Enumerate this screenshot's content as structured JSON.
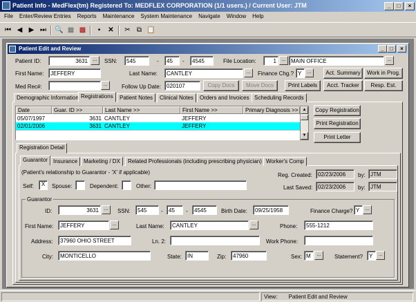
{
  "window": {
    "title": "Patient Info - MedFlex(tm)    Registered To: MEDFLEX CORPORATION (1/1 users.) / Current User: JTM"
  },
  "menu": [
    "File",
    "Enter/Review Entries",
    "Reports",
    "Maintenance",
    "System Maintenance",
    "Navigate",
    "Window",
    "Help"
  ],
  "toolbar_icons": [
    "first-record-icon",
    "prev-record-icon",
    "next-record-icon",
    "last-record-icon",
    "search-icon",
    "grid-icon",
    "delete-grid-icon",
    "save-icon",
    "close-icon",
    "cut-icon",
    "copy-icon",
    "paste-icon"
  ],
  "child": {
    "title": "Patient Edit and Review"
  },
  "header": {
    "patient_id_label": "Patient ID:",
    "patient_id": "3631",
    "ssn_label": "SSN:",
    "ssn1": "545",
    "ssn2": "45",
    "ssn3": "4545",
    "file_location_label": "File Location:",
    "file_location_num": "1",
    "file_location_name": "MAIN OFFICE",
    "first_name_label": "First Name:",
    "first_name": "JEFFERY",
    "last_name_label": "Last Name:",
    "last_name": "CANTLEY",
    "finance_chg_label": "Finance Chg.?",
    "finance_chg": "Y",
    "med_rec_label": "Med Rec#:",
    "med_rec": "",
    "follow_up_label": "Follow Up Date:",
    "follow_up": "020107",
    "dash": "-",
    "ellipsis": "...",
    "check_mark": "X"
  },
  "header_buttons": {
    "act_summary": "Act. Summary",
    "work_in_prog": "Work in Prog.",
    "copy_docs": "Copy Docs",
    "move_docs": "Move Docs",
    "print_labels": "Print Labels",
    "acct_tracker": "Acct. Tracker",
    "resp_est": "Resp. Est."
  },
  "main_tabs": [
    "Demographic Information",
    "Registrations",
    "Patient Notes",
    "Clinical Notes",
    "Orders and Invoices",
    "Scheduling Records"
  ],
  "grid": {
    "headers": [
      "Date",
      "Guar. ID >>",
      "Last Name >>",
      "First Name >>",
      "Primary Diagnosis >>"
    ],
    "rows": [
      [
        "05/07/1997",
        "3631",
        "CANTLEY",
        "JEFFERY",
        ""
      ],
      [
        "02/01/2006",
        "3631",
        "CANTLEY",
        "JEFFERY",
        ""
      ]
    ]
  },
  "reg_buttons": {
    "copy": "Copy Registration",
    "print": "Print Registration",
    "letter": "Print Letter"
  },
  "reg_detail_tab": "Registration Detail",
  "sub_tabs": [
    "Guarantor",
    "Insurance",
    "Marketing / DX",
    "Related Professionals (including prescribing physician)",
    "Worker's Comp"
  ],
  "relationship": {
    "note": "(Patient's relationship to Guarantor - 'X' if applicable)",
    "self": "Self:",
    "self_val": "X",
    "spouse": "Spouse:",
    "dependent": "Dependent:",
    "other": "Other:"
  },
  "reg_info": {
    "created_label": "Reg. Created:",
    "created": "02/23/2006",
    "by_label": "by:",
    "created_by": "JTM",
    "saved_label": "Last Saved:",
    "saved": "02/23/2006",
    "saved_by": "JTM"
  },
  "guarantor": {
    "group_label": "Guarantor",
    "id_label": "ID:",
    "id": "3631",
    "ssn_label": "SSN:",
    "ssn1": "545",
    "ssn2": "45",
    "ssn3": "4545",
    "birth_label": "Birth Date:",
    "birth": "09/25/1958",
    "finance_label": "Finance Charge?",
    "finance": "Y",
    "first_label": "First Name:",
    "first": "JEFFERY",
    "last_label": "Last Name:",
    "last": "CANTLEY",
    "phone_label": "Phone:",
    "phone": "555-1212",
    "address_label": "Address:",
    "address": "37960 OHIO STREET",
    "ln2_label": "Ln. 2:",
    "ln2": "",
    "work_label": "Work Phone:",
    "work": "",
    "city_label": "City:",
    "city": "MONTICELLO",
    "state_label": "State:",
    "state": "IN",
    "zip_label": "Zip:",
    "zip": "47960",
    "sex_label": "Sex:",
    "sex": "M",
    "statement_label": "Statement?",
    "statement": "Y"
  },
  "status": {
    "view_label": "View:",
    "view": "Patient Edit and Review"
  }
}
